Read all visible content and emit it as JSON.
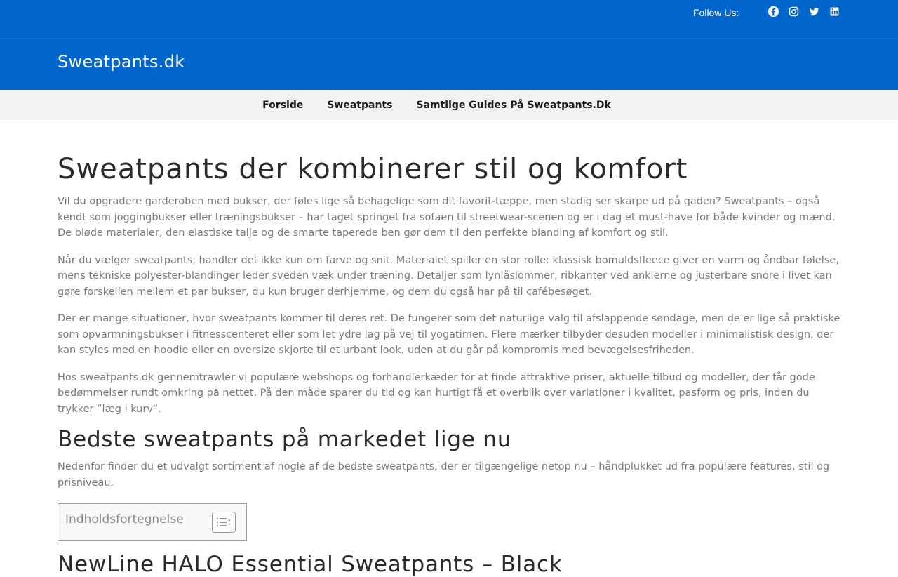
{
  "topbar": {
    "follow_label": "Follow Us:",
    "social_icons": [
      "facebook-icon",
      "instagram-icon",
      "twitter-icon",
      "linkedin-icon"
    ]
  },
  "brand": {
    "name": "Sweatpants.dk"
  },
  "nav": {
    "items": [
      "Forside",
      "Sweatpants",
      "Samtlige Guides På Sweatpants.Dk"
    ]
  },
  "article": {
    "title": "Sweatpants der kombinerer stil og komfort",
    "paragraphs": [
      "Vil du opgradere garderoben med bukser, der føles lige så behagelige som dit favorit-tæppe, men stadig ser skarpe ud på gaden? Sweatpants – også kendt som joggingbukser eller træningsbukser – har taget springet fra sofaen til streetwear-scenen og er i dag et must-have for både kvinder og mænd. De bløde materialer, den elastiske talje og de smarte taperede ben gør dem til den perfekte blanding af komfort og stil.",
      "Når du vælger sweatpants, handler det ikke kun om farve og snit. Materialet spiller en stor rolle: klassisk bomuldsfleece giver en varm og åndbar følelse, mens tekniske polyester-blandinger leder sveden væk under træning. Detaljer som lynlåslommer, ribkanter ved anklerne og justerbare snore i livet kan gøre forskellen mellem et par bukser, du kun bruger derhjemme, og dem du også har på til cafébesøget.",
      "Der er mange situationer, hvor sweatpants kommer til deres ret. De fungerer som det naturlige valg til afslappende søndage, men de er lige så praktiske som opvarmningsbukser i fitnesscenteret eller som let ydre lag på vej til yogatimen. Flere mærker tilbyder desuden modeller i minimalistisk design, der kan styles med en hoodie eller en oversize skjorte til et urbant look, uden at du går på kompromis med bevægelsesfriheden.",
      "Hos sweatpants.dk gennemtrawler vi populære webshops og forhandlerkæder for at finde attraktive priser, aktuelle tilbud og modeller, der får gode bedømmelser rundt omkring på nettet. På den måde sparer du tid og kan hurtigt få et overblik over variationer i kvalitet, pasform og pris, inden du trykker ”læg i kurv”."
    ],
    "section_title": "Bedste sweatpants på markedet lige nu",
    "section_intro": "Nedenfor finder du et udvalgt sortiment af nogle af de bedste sweatpants, der er tilgængelige netop nu – håndplukket ud fra populære features, stil og prisniveau.",
    "toc_label": "Indholdsfortegnelse",
    "product_title": "NewLine HALO Essential Sweatpants – Black"
  },
  "colors": {
    "brand_blue": "#0066cc",
    "nav_bg": "#f2f2f2"
  }
}
